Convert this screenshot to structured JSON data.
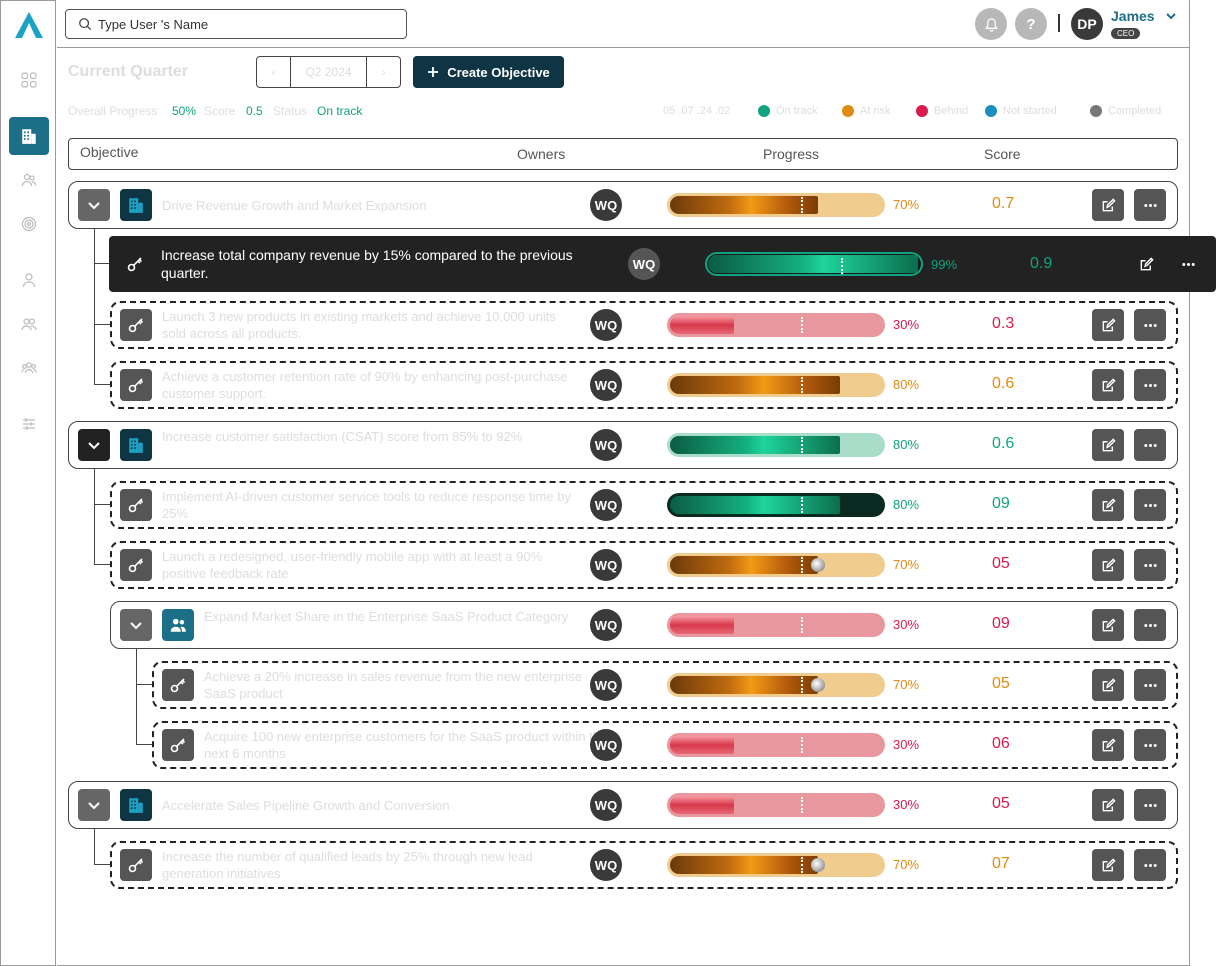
{
  "app": {
    "logo": "triangle-logo"
  },
  "sidebar": {
    "icons": [
      "grid-icon",
      "building-icon",
      "users-icon",
      "target-icon",
      "person-icon",
      "group-icon",
      "team-icon",
      "sliders-icon"
    ]
  },
  "search": {
    "placeholder": "Type User 's Name"
  },
  "header": {
    "notification_icon": "bell-icon",
    "help_label": "?",
    "user_initials": "DP",
    "user_name": "James",
    "user_role": "CEO"
  },
  "toolbar": {
    "quarter_title": "Current Quarter",
    "quarter_prev": "‹",
    "quarter_value": "Q2 2024",
    "quarter_next": "›",
    "create_label": "Create Objective"
  },
  "stats": {
    "progress_label": "Overall Progress",
    "progress_value": "50%",
    "score_label": "Score",
    "score_value": "0.5",
    "status_label": "Status",
    "status_value": "On track"
  },
  "legend": {
    "date": "05 .07 .24 .02",
    "items": [
      {
        "label": "On track",
        "color": "#10a37f"
      },
      {
        "label": "At risk",
        "color": "#e08a10"
      },
      {
        "label": "Behind",
        "color": "#d81b4c"
      },
      {
        "label": "Not started",
        "color": "#1b8fbf"
      },
      {
        "label": "Completed",
        "color": "#777777"
      }
    ]
  },
  "table": {
    "headers": {
      "objective": "Objective",
      "owners": "Owners",
      "progress": "Progress",
      "score": "Score"
    },
    "rows": [
      {
        "title": "Drive Revenue Growth and Market Expansion",
        "owner": "WQ",
        "pct": "70%",
        "progress": 0.7,
        "score": "0.7"
      },
      {
        "title": "Increase total company revenue by 15% compared to the previous quarter.",
        "owner": "WQ",
        "pct": "99%",
        "progress": 0.99,
        "score": "0.9"
      },
      {
        "title": "Launch 3 new products in existing markets and achieve 10,000 units sold across all products.",
        "owner": "WQ",
        "pct": "30%",
        "progress": 0.3,
        "score": "0.3"
      },
      {
        "title": "Achieve a customer retention rate of 90% by enhancing post-purchase customer support.",
        "owner": "WQ",
        "pct": "80%",
        "progress": 0.8,
        "score": "0.6"
      },
      {
        "title": "Increase customer satisfaction (CSAT) score from 85% to 92%",
        "owner": "WQ",
        "pct": "80%",
        "progress": 0.8,
        "score": "0.6"
      },
      {
        "title": "Implement AI-driven customer service tools to reduce response time by 25%",
        "owner": "WQ",
        "pct": "80%",
        "progress": 0.8,
        "score": "09"
      },
      {
        "title": "Launch a redesigned, user-friendly mobile app with at least a 90% positive feedback rate",
        "owner": "WQ",
        "pct": "70%",
        "progress": 0.7,
        "score": "05"
      },
      {
        "title": "Expand Market Share in the Enterprise SaaS Product Category",
        "owner": "WQ",
        "pct": "30%",
        "progress": 0.3,
        "score": "09"
      },
      {
        "title": "Achieve a 20% increase in sales revenue from the new enterprise SaaS product",
        "owner": "WQ",
        "pct": "70%",
        "progress": 0.7,
        "score": "05"
      },
      {
        "title": "Acquire 100 new enterprise customers for the SaaS product within the next 6 months",
        "owner": "WQ",
        "pct": "30%",
        "progress": 0.3,
        "score": "06"
      },
      {
        "title": "Accelerate Sales Pipeline Growth and Conversion",
        "owner": "WQ",
        "pct": "30%",
        "progress": 0.3,
        "score": "05"
      },
      {
        "title": "Increase the number of qualified leads by 25% through new lead generation initiatives",
        "owner": "WQ",
        "pct": "70%",
        "progress": 0.7,
        "score": "07"
      }
    ]
  }
}
